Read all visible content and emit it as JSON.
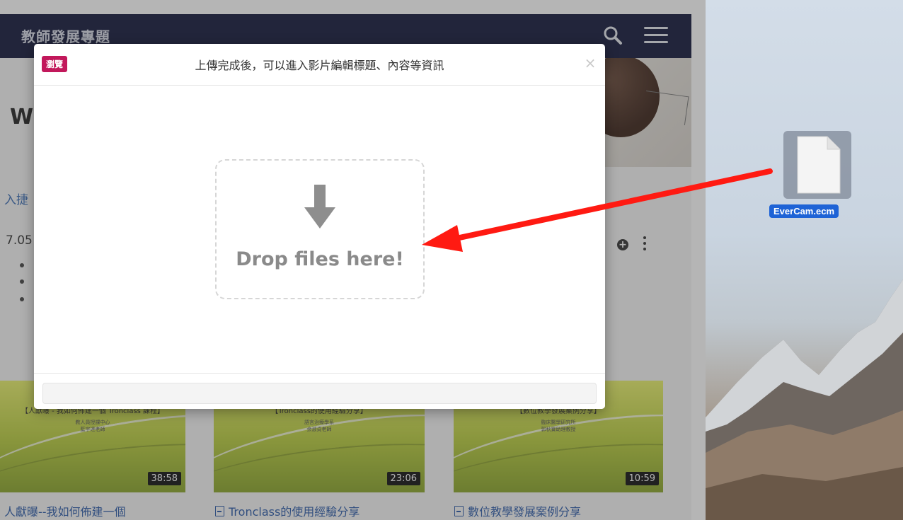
{
  "site": {
    "title": "教師發展專題",
    "hero_text": "W",
    "quick_link": "入捷",
    "partial_number": "7.05",
    "cards": [
      {
        "thumb_title": "【人獻曝 - 我如何佈建一個 Tronclass 課程】",
        "thumb_sub1": "教人員授課中心",
        "thumb_sub2": "藍宇達老師",
        "duration": "38:58",
        "caption": "人獻曝--我如何佈建一個"
      },
      {
        "thumb_title": "【Tronclass的使用經驗分享】",
        "thumb_sub1": "語言治療學系",
        "thumb_sub2": "余淑貞老師",
        "duration": "23:06",
        "caption": "Tronclass的使用經驗分享"
      },
      {
        "thumb_title": "【數位教學發展案例分享】",
        "thumb_sub1": "臨床醫學研究所",
        "thumb_sub2": "郭秋實助理教授",
        "duration": "10:59",
        "caption": "數位教學發展案例分享"
      }
    ]
  },
  "modal": {
    "browse_label": "瀏覽",
    "title": "上傳完成後，可以進入影片編輯標題、內容等資訊",
    "close_label": "×",
    "dropzone_text": "Drop files here!"
  },
  "desktop": {
    "file_name": "EverCam.ecm"
  },
  "colors": {
    "nav_bg": "#12183a",
    "browse_bg": "#c2185b",
    "arrow": "#ff1a12",
    "file_label_bg": "#1e63d6"
  },
  "icons": [
    "search-icon",
    "menu-icon",
    "plus-circle-icon",
    "kebab-icon",
    "document-icon",
    "close-icon",
    "download-arrow-icon",
    "file-icon"
  ]
}
